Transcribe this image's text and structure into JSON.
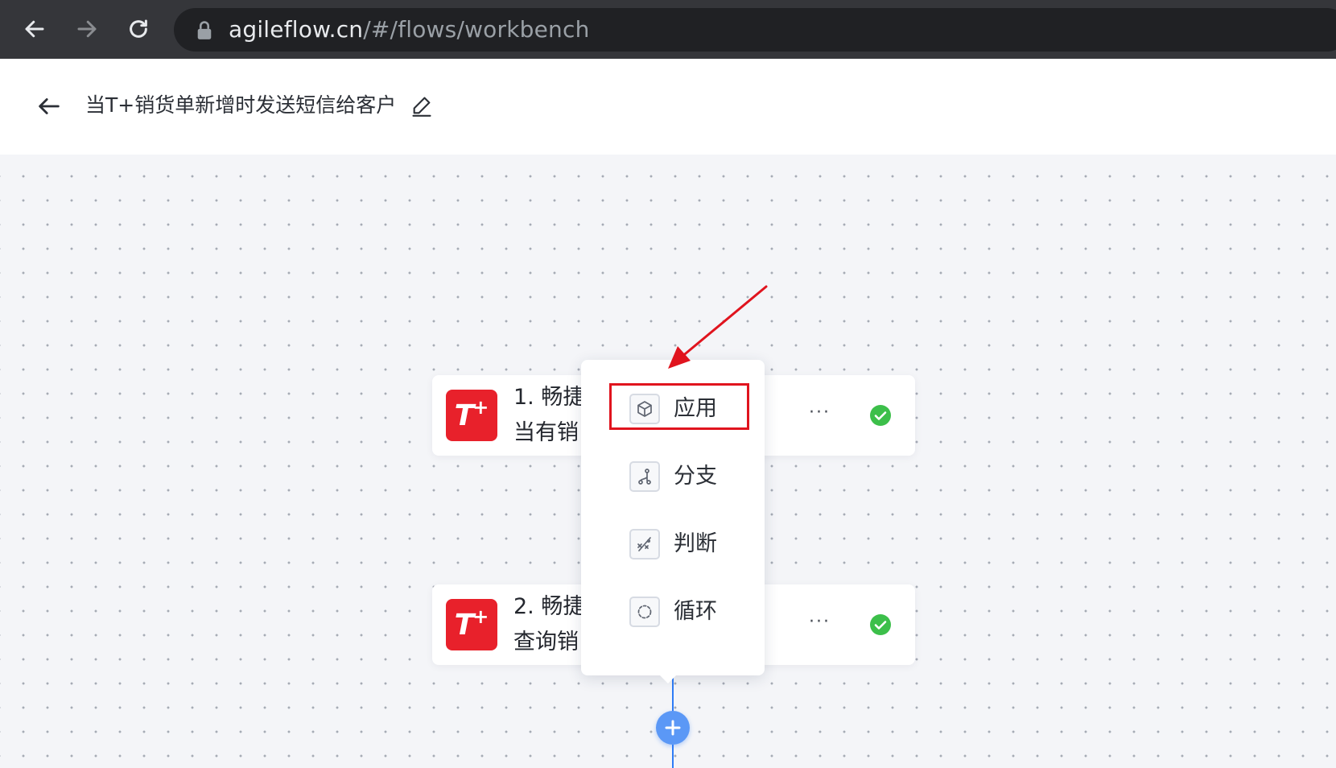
{
  "browser": {
    "url_host": "agileflow.cn",
    "url_path": "/#/flows/workbench"
  },
  "header": {
    "title": "当T+销货单新增时发送短信给客户"
  },
  "nodes": [
    {
      "step_line1": "1. 畅捷",
      "step_line2": "当有销",
      "colon": ":",
      "more": "···"
    },
    {
      "step_line1": "2. 畅捷",
      "step_line2": "查询销",
      "colon": ":",
      "more": "···"
    }
  ],
  "node_logo": {
    "t": "T",
    "plus": "+"
  },
  "menu": {
    "items": [
      {
        "label": "应用",
        "icon": "cube-icon"
      },
      {
        "label": "分支",
        "icon": "branch-icon"
      },
      {
        "label": "判断",
        "icon": "condition-icon"
      },
      {
        "label": "循环",
        "icon": "loop-icon"
      }
    ]
  },
  "colors": {
    "accent": "#2f7cf6",
    "brand_red": "#e8212b",
    "success": "#3cbf4a",
    "annotation": "#e0141e"
  }
}
